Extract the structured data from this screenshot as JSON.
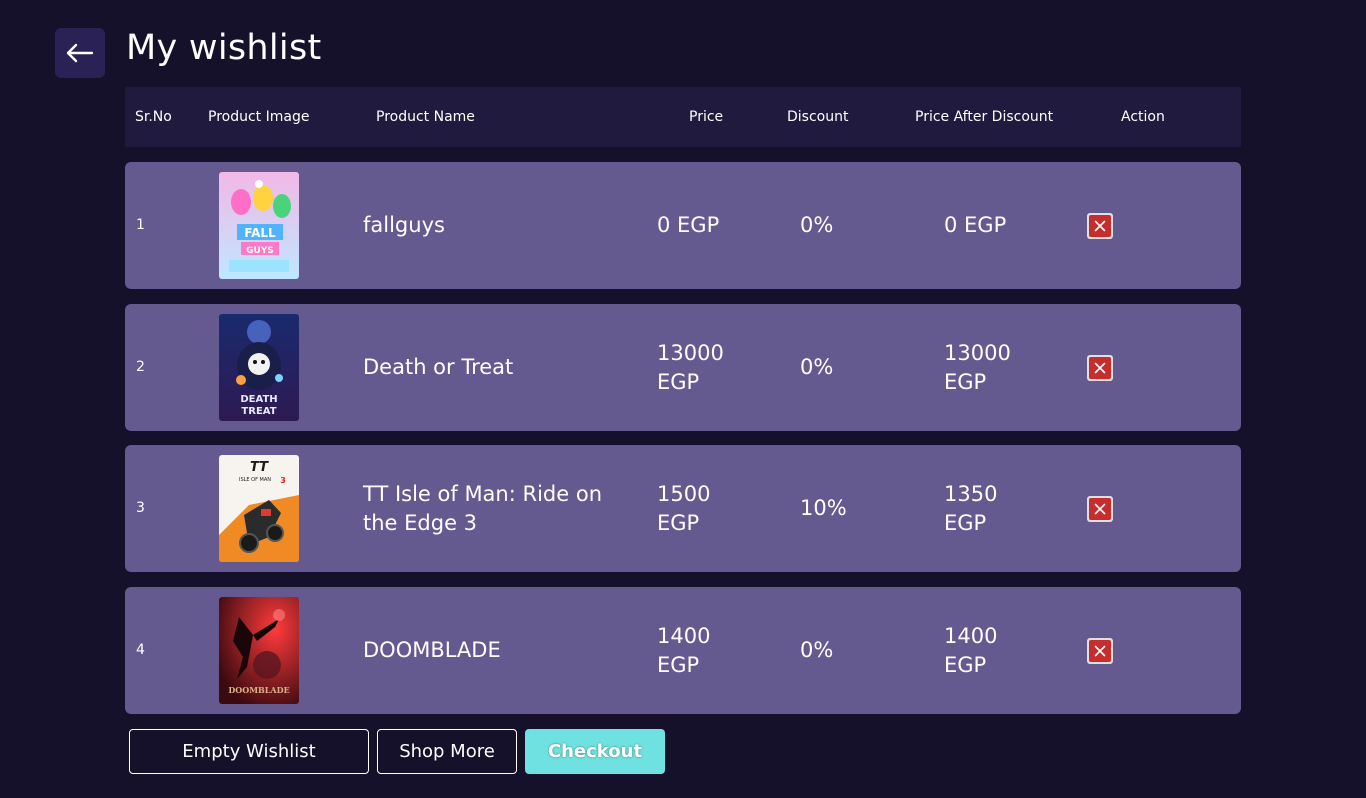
{
  "page": {
    "title": "My wishlist",
    "back_icon": "arrow-left-icon"
  },
  "table": {
    "headers": {
      "sr_no": "Sr.No",
      "product_image": "Product Image",
      "product_name": "Product Name",
      "price": "Price",
      "discount": "Discount",
      "price_after_discount": "Price After Discount",
      "action": "Action"
    },
    "rows": [
      {
        "sr": "1",
        "image_icon": "fallguys-cover-image",
        "name": "fallguys",
        "price": "0 EGP",
        "discount": "0%",
        "final_price": "0 EGP",
        "action_icon": "remove-icon"
      },
      {
        "sr": "2",
        "image_icon": "death-or-treat-cover-image",
        "name": "Death or Treat",
        "price": "13000 EGP",
        "discount": "0%",
        "final_price": "13000 EGP",
        "action_icon": "remove-icon"
      },
      {
        "sr": "3",
        "image_icon": "tt-isle-of-man-cover-image",
        "name": "TT Isle of Man: Ride on the Edge 3",
        "price": "1500 EGP",
        "discount": "10%",
        "final_price": "1350 EGP",
        "action_icon": "remove-icon"
      },
      {
        "sr": "4",
        "image_icon": "doomblade-cover-image",
        "name": "DOOMBLADE",
        "price": "1400 EGP",
        "discount": "0%",
        "final_price": "1400 EGP",
        "action_icon": "remove-icon"
      }
    ]
  },
  "actions": {
    "empty_label": "Empty Wishlist",
    "shop_more_label": "Shop More",
    "checkout_label": "Checkout"
  },
  "colors": {
    "background": "#15112b",
    "header_bg": "#1f1a3e",
    "row_bg": "#655a8f",
    "back_button_bg": "#2a2155",
    "delete_red": "#c62d2d",
    "checkout_bg": "#6fe1e1"
  }
}
